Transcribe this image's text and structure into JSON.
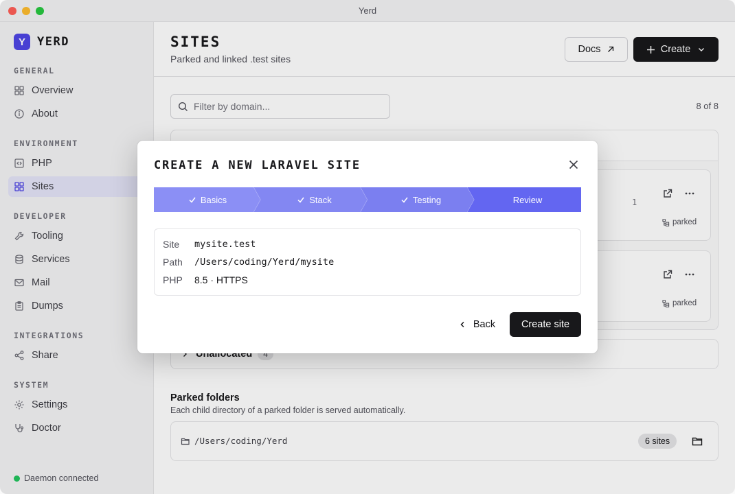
{
  "window": {
    "title": "Yerd"
  },
  "brand": {
    "logo_letter": "Y",
    "name": "YERD",
    "accent": "#4f46e5"
  },
  "sidebar": {
    "sections": [
      {
        "label": "General",
        "items": [
          {
            "label": "Overview",
            "icon": "grid-icon"
          },
          {
            "label": "About",
            "icon": "info-icon"
          }
        ]
      },
      {
        "label": "Environment",
        "items": [
          {
            "label": "PHP",
            "icon": "code-icon"
          },
          {
            "label": "Sites",
            "icon": "grid-icon",
            "active": true
          }
        ]
      },
      {
        "label": "Developer",
        "items": [
          {
            "label": "Tooling",
            "icon": "wrench-icon"
          },
          {
            "label": "Services",
            "icon": "database-icon"
          },
          {
            "label": "Mail",
            "icon": "mail-icon"
          },
          {
            "label": "Dumps",
            "icon": "clipboard-icon"
          }
        ]
      },
      {
        "label": "Integrations",
        "items": [
          {
            "label": "Share",
            "icon": "share-icon"
          }
        ]
      },
      {
        "label": "System",
        "items": [
          {
            "label": "Settings",
            "icon": "gear-icon"
          },
          {
            "label": "Doctor",
            "icon": "stethoscope-icon"
          }
        ]
      }
    ],
    "status": {
      "label": "Daemon connected",
      "color": "#22c55e"
    }
  },
  "header": {
    "title": "SITES",
    "subtitle": "Parked and linked .test sites",
    "docs_label": "Docs",
    "create_label": "Create"
  },
  "filter": {
    "placeholder": "Filter by domain...",
    "count": "8 of 8"
  },
  "site_cards": [
    {
      "version": "1",
      "tag": "parked"
    },
    {
      "version": "",
      "tag": "parked"
    }
  ],
  "unallocated": {
    "label": "Unallocated",
    "count": "4"
  },
  "parked": {
    "title": "Parked folders",
    "description": "Each child directory of a parked folder is served automatically.",
    "folders": [
      {
        "path": "/Users/coding/Yerd",
        "sites": "6 sites"
      }
    ]
  },
  "modal": {
    "title": "CREATE A NEW LARAVEL SITE",
    "steps": [
      {
        "label": "Basics",
        "done": true,
        "color": "#8b8ff5"
      },
      {
        "label": "Stack",
        "done": true,
        "color": "#8387f2"
      },
      {
        "label": "Testing",
        "done": true,
        "color": "#7b7ff0"
      },
      {
        "label": "Review",
        "done": false,
        "color": "#6366f1"
      }
    ],
    "summary": [
      {
        "label": "Site",
        "value": "mysite.test",
        "mono": true
      },
      {
        "label": "Path",
        "value": "/Users/coding/Yerd/mysite",
        "mono": true
      },
      {
        "label": "PHP",
        "value": "8.5 · HTTPS",
        "mono": false
      }
    ],
    "back_label": "Back",
    "submit_label": "Create site"
  }
}
